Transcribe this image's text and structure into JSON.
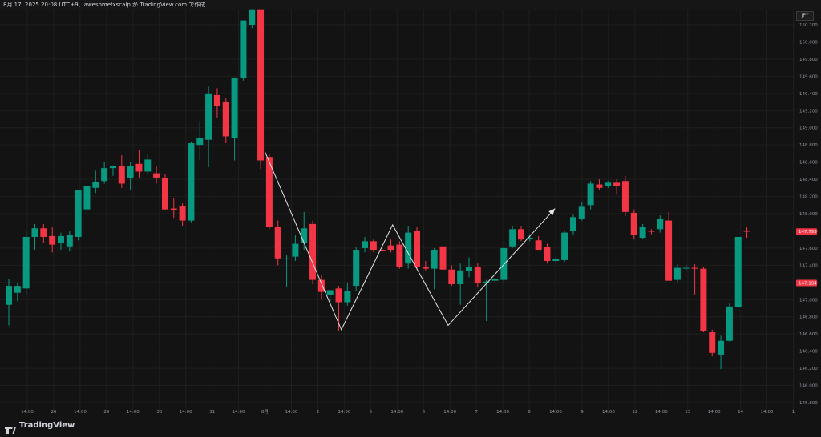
{
  "header": {
    "text": "8月 17, 2025 20:08 UTC+9、awesomefxscalp が TradingView.com で作成"
  },
  "instrument": {
    "currency": "JPY"
  },
  "colors": {
    "up": "#089981",
    "down": "#f23645",
    "background": "#131313",
    "grid": "#1f1f1f",
    "pattern_line": "#e6e6e6"
  },
  "price_axis": {
    "ticks": [
      "150.200",
      "150.000",
      "149.800",
      "149.600",
      "149.400",
      "149.200",
      "149.000",
      "148.800",
      "148.600",
      "148.400",
      "148.200",
      "148.000",
      "147.800",
      "147.600",
      "147.400",
      "147.200",
      "147.000",
      "146.800",
      "146.600",
      "146.400",
      "146.200",
      "146.000",
      "145.800"
    ],
    "last_price_tags": [
      {
        "label": "147.793",
        "value": 147.793,
        "color": "#f23645"
      },
      {
        "label": "147.194",
        "value": 147.194,
        "color": "#f23645"
      }
    ]
  },
  "time_axis": {
    "labels": [
      "14:00",
      "26",
      "14:00",
      "29",
      "14:00",
      "30",
      "14:00",
      "31",
      "14:00",
      "8月",
      "14:00",
      "2",
      "14:00",
      "5",
      "14:00",
      "6",
      "14:00",
      "7",
      "14:00",
      "8",
      "14:00",
      "9",
      "14:00",
      "12",
      "14:00",
      "13",
      "14:00",
      "14",
      "14:00",
      "1"
    ]
  },
  "chart_data": {
    "type": "candlestick",
    "title": "",
    "ylim": [
      145.77,
      150.38
    ],
    "grid": true,
    "candles": [
      {
        "o": 146.94,
        "h": 147.24,
        "l": 146.7,
        "c": 147.16
      },
      {
        "o": 147.08,
        "h": 147.2,
        "l": 146.98,
        "c": 147.16
      },
      {
        "o": 147.13,
        "h": 147.8,
        "l": 147.05,
        "c": 147.73
      },
      {
        "o": 147.73,
        "h": 147.88,
        "l": 147.58,
        "c": 147.83
      },
      {
        "o": 147.83,
        "h": 147.88,
        "l": 147.66,
        "c": 147.73
      },
      {
        "o": 147.74,
        "h": 147.84,
        "l": 147.55,
        "c": 147.64
      },
      {
        "o": 147.66,
        "h": 147.78,
        "l": 147.58,
        "c": 147.74
      },
      {
        "o": 147.62,
        "h": 147.8,
        "l": 147.56,
        "c": 147.75
      },
      {
        "o": 147.73,
        "h": 148.27,
        "l": 147.69,
        "c": 148.27
      },
      {
        "o": 148.05,
        "h": 148.4,
        "l": 147.96,
        "c": 148.32
      },
      {
        "o": 148.3,
        "h": 148.5,
        "l": 148.24,
        "c": 148.37
      },
      {
        "o": 148.38,
        "h": 148.6,
        "l": 148.35,
        "c": 148.53
      },
      {
        "o": 148.53,
        "h": 148.56,
        "l": 148.44,
        "c": 148.55
      },
      {
        "o": 148.55,
        "h": 148.68,
        "l": 148.3,
        "c": 148.35
      },
      {
        "o": 148.42,
        "h": 148.6,
        "l": 148.28,
        "c": 148.55
      },
      {
        "o": 148.58,
        "h": 148.74,
        "l": 148.42,
        "c": 148.49
      },
      {
        "o": 148.49,
        "h": 148.7,
        "l": 148.45,
        "c": 148.63
      },
      {
        "o": 148.47,
        "h": 148.56,
        "l": 148.35,
        "c": 148.42
      },
      {
        "o": 148.42,
        "h": 148.46,
        "l": 148.04,
        "c": 148.05
      },
      {
        "o": 148.06,
        "h": 148.18,
        "l": 147.95,
        "c": 148.04
      },
      {
        "o": 148.09,
        "h": 148.12,
        "l": 147.86,
        "c": 147.92
      },
      {
        "o": 147.92,
        "h": 148.84,
        "l": 147.9,
        "c": 148.82
      },
      {
        "o": 148.8,
        "h": 149.08,
        "l": 148.62,
        "c": 148.88
      },
      {
        "o": 148.86,
        "h": 149.48,
        "l": 148.54,
        "c": 149.4
      },
      {
        "o": 149.38,
        "h": 149.46,
        "l": 149.12,
        "c": 149.25
      },
      {
        "o": 149.3,
        "h": 149.35,
        "l": 148.82,
        "c": 148.9
      },
      {
        "o": 148.88,
        "h": 149.58,
        "l": 148.62,
        "c": 149.58
      },
      {
        "o": 149.58,
        "h": 150.25,
        "l": 149.55,
        "c": 150.25
      },
      {
        "o": 150.2,
        "h": 150.38,
        "l": 150.16,
        "c": 150.38
      },
      {
        "o": 150.38,
        "h": 150.38,
        "l": 148.52,
        "c": 148.62
      },
      {
        "o": 148.66,
        "h": 148.7,
        "l": 147.82,
        "c": 147.85
      },
      {
        "o": 147.85,
        "h": 147.92,
        "l": 147.4,
        "c": 147.48
      },
      {
        "o": 147.48,
        "h": 147.52,
        "l": 147.15,
        "c": 147.48
      },
      {
        "o": 147.5,
        "h": 147.75,
        "l": 147.45,
        "c": 147.65
      },
      {
        "o": 147.66,
        "h": 148.02,
        "l": 147.58,
        "c": 147.83
      },
      {
        "o": 147.88,
        "h": 147.92,
        "l": 147.18,
        "c": 147.23
      },
      {
        "o": 147.23,
        "h": 147.29,
        "l": 147.0,
        "c": 147.09
      },
      {
        "o": 147.05,
        "h": 147.11,
        "l": 146.95,
        "c": 147.11
      },
      {
        "o": 147.13,
        "h": 147.16,
        "l": 146.63,
        "c": 146.97
      },
      {
        "o": 146.97,
        "h": 147.2,
        "l": 146.93,
        "c": 147.1
      },
      {
        "o": 147.16,
        "h": 147.61,
        "l": 147.1,
        "c": 147.58
      },
      {
        "o": 147.6,
        "h": 147.73,
        "l": 147.55,
        "c": 147.68
      },
      {
        "o": 147.68,
        "h": 147.7,
        "l": 147.55,
        "c": 147.58
      },
      {
        "o": 147.58,
        "h": 147.6,
        "l": 147.55,
        "c": 147.57
      },
      {
        "o": 147.63,
        "h": 147.7,
        "l": 147.55,
        "c": 147.58
      },
      {
        "o": 147.64,
        "h": 147.68,
        "l": 147.36,
        "c": 147.38
      },
      {
        "o": 147.42,
        "h": 147.86,
        "l": 147.36,
        "c": 147.78
      },
      {
        "o": 147.8,
        "h": 147.85,
        "l": 147.35,
        "c": 147.38
      },
      {
        "o": 147.38,
        "h": 147.45,
        "l": 147.34,
        "c": 147.36
      },
      {
        "o": 147.36,
        "h": 147.6,
        "l": 147.12,
        "c": 147.58
      },
      {
        "o": 147.62,
        "h": 147.65,
        "l": 147.3,
        "c": 147.35
      },
      {
        "o": 147.35,
        "h": 147.4,
        "l": 147.16,
        "c": 147.18
      },
      {
        "o": 147.18,
        "h": 147.42,
        "l": 146.94,
        "c": 147.34
      },
      {
        "o": 147.33,
        "h": 147.49,
        "l": 147.26,
        "c": 147.38
      },
      {
        "o": 147.38,
        "h": 147.42,
        "l": 147.15,
        "c": 147.19
      },
      {
        "o": 147.19,
        "h": 147.23,
        "l": 146.75,
        "c": 147.21
      },
      {
        "o": 147.22,
        "h": 147.28,
        "l": 147.18,
        "c": 147.24
      },
      {
        "o": 147.23,
        "h": 147.62,
        "l": 147.2,
        "c": 147.6
      },
      {
        "o": 147.62,
        "h": 147.86,
        "l": 147.6,
        "c": 147.82
      },
      {
        "o": 147.82,
        "h": 147.86,
        "l": 147.68,
        "c": 147.7
      },
      {
        "o": 147.71,
        "h": 147.76,
        "l": 147.68,
        "c": 147.72
      },
      {
        "o": 147.69,
        "h": 147.74,
        "l": 147.58,
        "c": 147.58
      },
      {
        "o": 147.61,
        "h": 147.65,
        "l": 147.42,
        "c": 147.45
      },
      {
        "o": 147.45,
        "h": 147.5,
        "l": 147.42,
        "c": 147.47
      },
      {
        "o": 147.46,
        "h": 147.8,
        "l": 147.44,
        "c": 147.78
      },
      {
        "o": 147.8,
        "h": 148.0,
        "l": 147.76,
        "c": 147.96
      },
      {
        "o": 147.94,
        "h": 148.14,
        "l": 147.92,
        "c": 148.08
      },
      {
        "o": 148.1,
        "h": 148.38,
        "l": 148.05,
        "c": 148.35
      },
      {
        "o": 148.34,
        "h": 148.4,
        "l": 148.28,
        "c": 148.3
      },
      {
        "o": 148.32,
        "h": 148.38,
        "l": 148.3,
        "c": 148.36
      },
      {
        "o": 148.36,
        "h": 148.4,
        "l": 148.22,
        "c": 148.32
      },
      {
        "o": 148.38,
        "h": 148.44,
        "l": 147.97,
        "c": 148.02
      },
      {
        "o": 148.01,
        "h": 148.05,
        "l": 147.7,
        "c": 147.75
      },
      {
        "o": 147.72,
        "h": 147.88,
        "l": 147.7,
        "c": 147.85
      },
      {
        "o": 147.8,
        "h": 147.82,
        "l": 147.76,
        "c": 147.79
      },
      {
        "o": 147.82,
        "h": 147.98,
        "l": 147.78,
        "c": 147.94
      },
      {
        "o": 147.92,
        "h": 148.02,
        "l": 147.22,
        "c": 147.22
      },
      {
        "o": 147.23,
        "h": 147.41,
        "l": 147.2,
        "c": 147.37
      },
      {
        "o": 147.37,
        "h": 147.41,
        "l": 147.34,
        "c": 147.37
      },
      {
        "o": 147.37,
        "h": 147.41,
        "l": 147.06,
        "c": 147.36
      },
      {
        "o": 147.36,
        "h": 147.38,
        "l": 146.62,
        "c": 146.63
      },
      {
        "o": 146.62,
        "h": 146.65,
        "l": 146.34,
        "c": 146.38
      },
      {
        "o": 146.36,
        "h": 146.58,
        "l": 146.19,
        "c": 146.52
      },
      {
        "o": 146.52,
        "h": 146.96,
        "l": 146.51,
        "c": 146.92
      },
      {
        "o": 146.91,
        "h": 147.73,
        "l": 146.9,
        "c": 147.73
      },
      {
        "o": 147.8,
        "h": 147.84,
        "l": 147.72,
        "c": 147.79
      }
    ],
    "pattern_line": [
      {
        "i": 29.5,
        "y": 148.72
      },
      {
        "i": 38.3,
        "y": 146.65
      },
      {
        "i": 44.2,
        "y": 147.87
      },
      {
        "i": 50.6,
        "y": 146.7
      },
      {
        "i": 62.9,
        "y": 148.06
      }
    ]
  },
  "branding": {
    "logo_text": "TradingView"
  }
}
